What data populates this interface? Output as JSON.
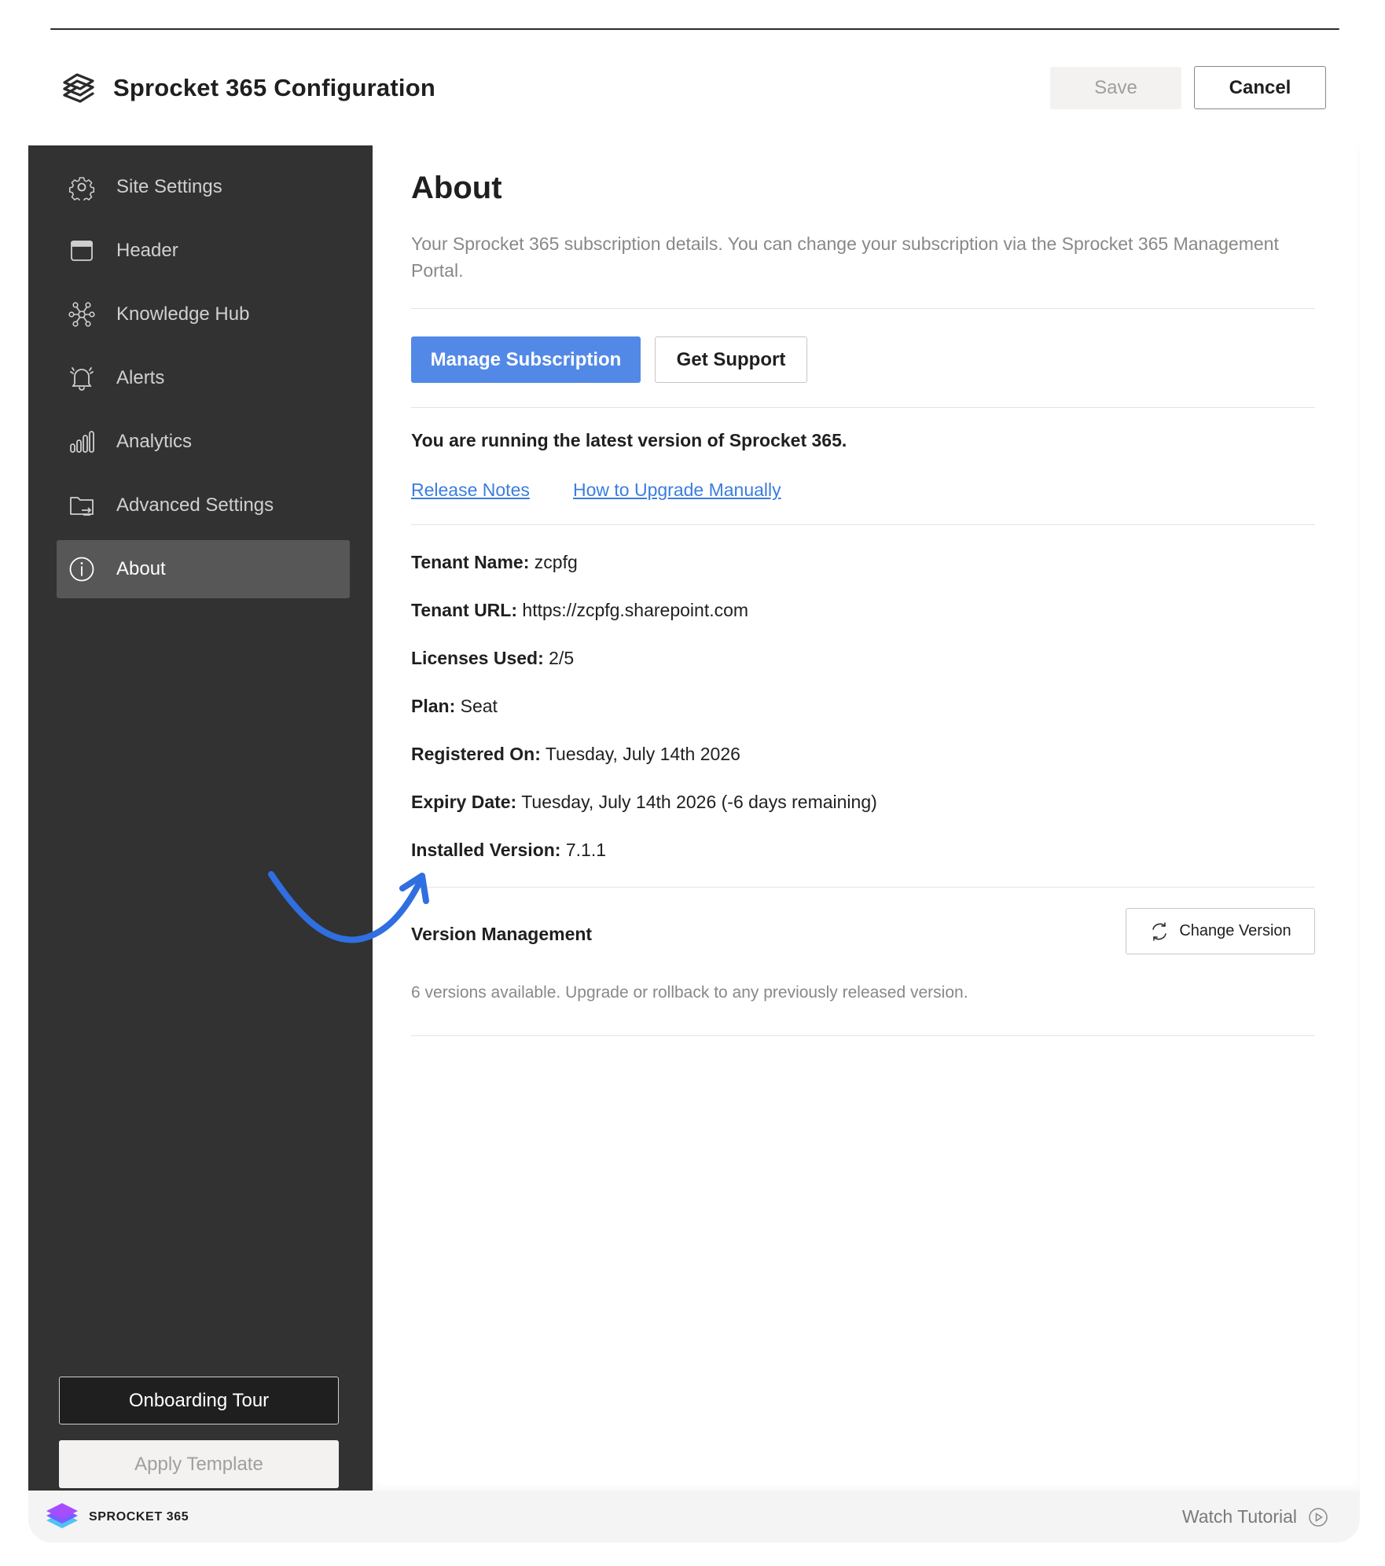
{
  "app": {
    "title": "Sprocket 365 Configuration",
    "accent_color": "#5389e6"
  },
  "toolbar": {
    "save_label": "Save",
    "cancel_label": "Cancel"
  },
  "sidebar": {
    "items": [
      {
        "label": "Site Settings",
        "icon": "gear-icon"
      },
      {
        "label": "Header",
        "icon": "window-icon"
      },
      {
        "label": "Knowledge Hub",
        "icon": "network-icon"
      },
      {
        "label": "Alerts",
        "icon": "bell-icon"
      },
      {
        "label": "Analytics",
        "icon": "bar-chart-icon"
      },
      {
        "label": "Advanced Settings",
        "icon": "folder-sync-icon"
      },
      {
        "label": "About",
        "icon": "info-icon",
        "active": true
      }
    ],
    "onboarding_label": "Onboarding Tour",
    "template_label": "Apply Template"
  },
  "main": {
    "title": "About",
    "description": "Your Sprocket 365 subscription details. You can change your subscription via the Sprocket 365 Management Portal.",
    "manage_label": "Manage Subscription",
    "support_label": "Get Support",
    "latest_message": "You are running the latest version of Sprocket 365.",
    "links": {
      "release_notes": "Release Notes",
      "upgrade_manually": "How to Upgrade Manually"
    },
    "info": {
      "tenant_name": {
        "label": "Tenant Name:",
        "value": "zcpfg"
      },
      "tenant_url": {
        "label": "Tenant URL:",
        "value": "https://zcpfg.sharepoint.com"
      },
      "licenses": {
        "label": "Licenses Used:",
        "value": "2/5"
      },
      "plan": {
        "label": "Plan:",
        "value": "Seat"
      },
      "registered": {
        "label": "Registered On:",
        "value": "Tuesday, July 14th 2026"
      },
      "expiry": {
        "label": "Expiry Date:",
        "value": "Tuesday, July 14th 2026 (-6 days remaining)"
      },
      "installed": {
        "label": "Installed Version:",
        "value": "7.1.1"
      }
    },
    "version_management": {
      "title": "Version Management",
      "change_label": "Change Version",
      "description": "6 versions available. Upgrade or rollback to any previously released version."
    }
  },
  "footer": {
    "brand": "SPROCKET 365",
    "watch_tutorial": "Watch Tutorial"
  }
}
